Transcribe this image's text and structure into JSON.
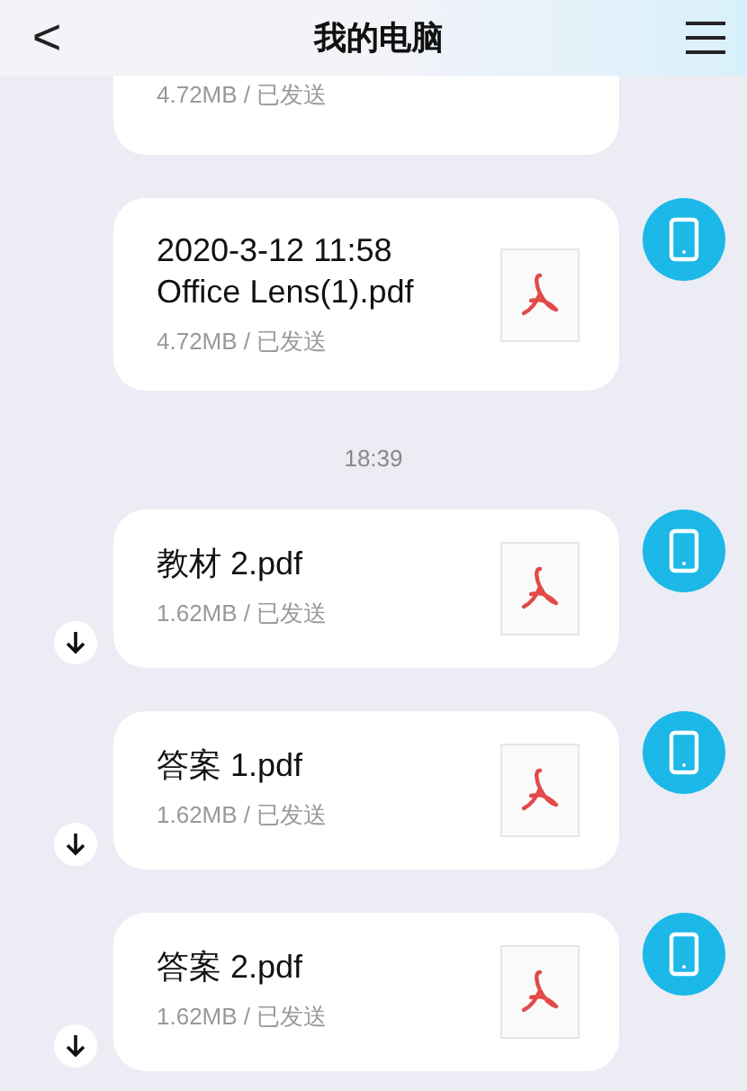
{
  "header": {
    "back": "<",
    "title": "我的电脑"
  },
  "messages": [
    {
      "kind": "file",
      "meta": "4.72MB / 已发送",
      "cut": true,
      "download": false
    },
    {
      "kind": "file",
      "title_lines": [
        "2020-3-12 11:58",
        "Office Lens(1).pdf"
      ],
      "meta": "4.72MB / 已发送",
      "cut": false,
      "download": false
    },
    {
      "kind": "time",
      "text": "18:39"
    },
    {
      "kind": "file",
      "title_lines": [
        "教材 2.pdf"
      ],
      "meta": "1.62MB / 已发送",
      "cut": false,
      "download": true
    },
    {
      "kind": "file",
      "title_lines": [
        "答案 1.pdf"
      ],
      "meta": "1.62MB / 已发送",
      "cut": false,
      "download": true
    },
    {
      "kind": "file",
      "title_lines": [
        "答案 2.pdf"
      ],
      "meta": "1.62MB / 已发送",
      "cut": false,
      "download": true
    }
  ]
}
